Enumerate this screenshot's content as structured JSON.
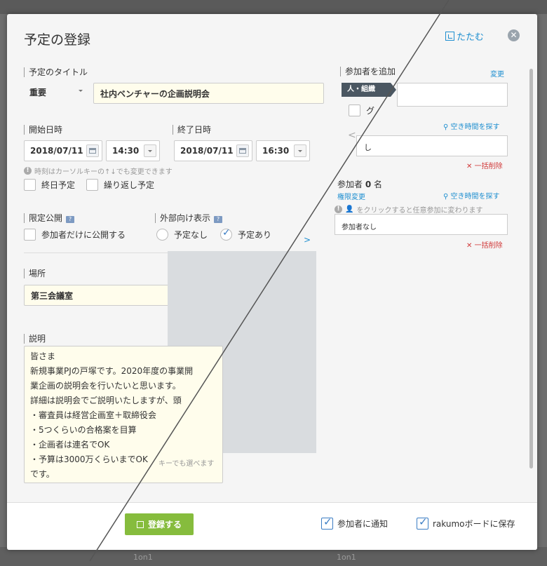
{
  "dialog": {
    "title": "予定の登録",
    "collapse_label": "たたむ",
    "close_glyph": "✕"
  },
  "event_title": {
    "label": "予定のタイトル",
    "priority": "重要",
    "value": "社内ベンチャーの企画説明会"
  },
  "start": {
    "label": "開始日時",
    "date": "2018/07/11",
    "time": "14:30"
  },
  "end": {
    "label": "終了日時",
    "date": "2018/07/11",
    "time": "16:30"
  },
  "time_hint": "時刻はカーソルキーの↑↓でも変更できます",
  "all_day_label": "終日予定",
  "repeat_label": "繰り返し予定",
  "private": {
    "label": "限定公開",
    "option": "参加者だけに公開する"
  },
  "external": {
    "label": "外部向け表示",
    "none": "予定なし",
    "yes": "予定あり",
    "selected": "予定あり"
  },
  "location": {
    "label": "場所",
    "value": "第三会議室"
  },
  "description": {
    "label": "説明",
    "lines": [
      "皆さま",
      "新規事業PJの戸塚です。2020年度の事業開",
      "業企画の説明会を行いたいと思います。",
      "詳細は説明会でご説明いたしますが、頭",
      "・審査員は経営企画室＋取締役会",
      "・5つくらいの合格案を目算",
      "・企画者は連名でOK",
      "・予算は3000万くらいまでOK",
      "です。"
    ],
    "key_hint": "キーでも選べます"
  },
  "participants_panel": {
    "label": "参加者を追加",
    "change_link": "変更",
    "tab": "人・組織",
    "group_item": "グ",
    "free_time_link": "空き時間を探す",
    "nav_prev": "<",
    "box_text": "し",
    "bulk_delete": "一括削除",
    "count_label": "参加者",
    "count_value": "0",
    "count_unit": "名",
    "permission_link": "権限変更",
    "free_time_link2": "空き時間を探す",
    "click_hint": "をクリックすると任意参加に変わります",
    "none_text": "参加者なし",
    "bulk_delete2": "一括削除"
  },
  "calendar_toggle": ">",
  "footer": {
    "save_label": "登録する",
    "notify_label": "参加者に通知",
    "board_label": "rakumoボードに保存"
  },
  "background": {
    "left_text": "1on1",
    "right_text": "1on1"
  },
  "colors": {
    "accent_blue": "#1f8fd0",
    "save_green": "#86bc3d",
    "delete_red": "#d13a3a",
    "input_yellow": "#fffdec"
  }
}
